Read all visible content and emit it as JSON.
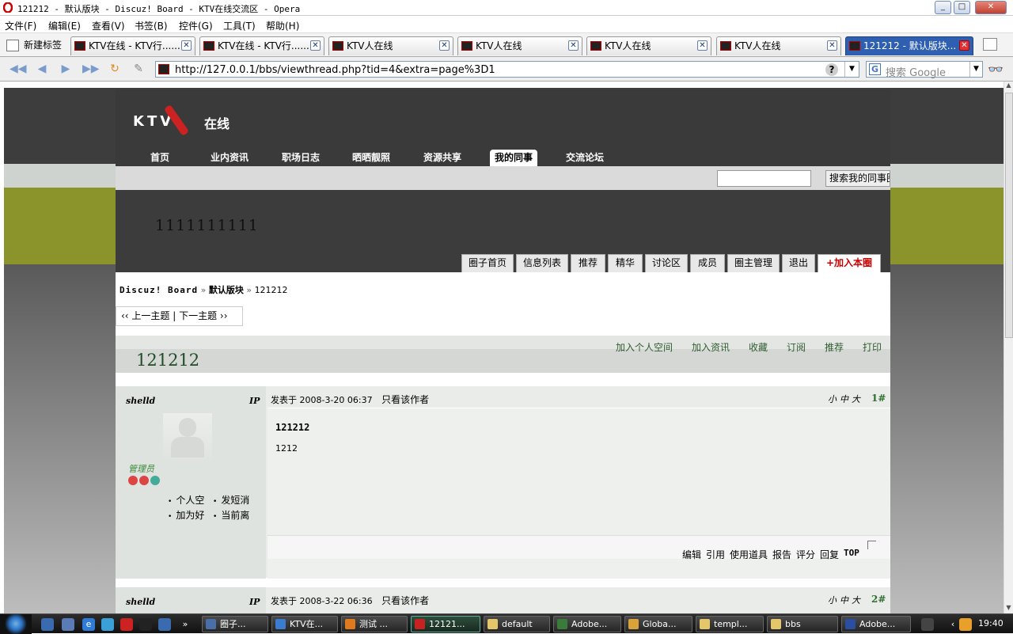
{
  "window": {
    "title": "121212 - 默认版块 - Discuz! Board - KTV在线交流区 - Opera",
    "controls": [
      "_",
      "□",
      "✕"
    ]
  },
  "menu": [
    "文件(F)",
    "编辑(E)",
    "查看(V)",
    "书签(B)",
    "控件(G)",
    "工具(T)",
    "帮助(H)"
  ],
  "tabs": {
    "new_tab_label": "新建标签",
    "items": [
      {
        "label": "KTV在线 - KTV行......",
        "active": false
      },
      {
        "label": "KTV在线 - KTV行......",
        "active": false
      },
      {
        "label": "KTV人在线",
        "active": false
      },
      {
        "label": "KTV人在线",
        "active": false
      },
      {
        "label": "KTV人在线",
        "active": false
      },
      {
        "label": "KTV人在线",
        "active": false
      },
      {
        "label": "121212 - 默认版块...",
        "active": true
      }
    ]
  },
  "address": {
    "url": "http://127.0.0.1/bbs/viewthread.php?tid=4&extra=page%3D1",
    "help": "?",
    "search_placeholder": "搜索 Google"
  },
  "site": {
    "logo_text": "KTV",
    "logo_suffix": "在线",
    "nav": [
      {
        "label": "首页",
        "active": false
      },
      {
        "label": "业内资讯",
        "active": false
      },
      {
        "label": "职场日志",
        "active": false
      },
      {
        "label": "晒晒靓照",
        "active": false
      },
      {
        "label": "资源共享",
        "active": false
      },
      {
        "label": "我的同事",
        "active": true
      },
      {
        "label": "交流论坛",
        "active": false
      }
    ],
    "search_button": "搜索我的同事圈",
    "circle_name": "1111111111",
    "circle_tabs": [
      "圈子首页",
      "信息列表",
      "推荐",
      "精华",
      "讨论区",
      "成员",
      "圈主管理",
      "退出",
      "+加入本圈"
    ]
  },
  "breadcrumb": {
    "root": "Discuz! Board",
    "sep": "»",
    "forum": "默认版块",
    "thread": "121212"
  },
  "thread_nav": "‹‹ 上一主题 | 下一主题 ››",
  "thread": {
    "title": "121212",
    "actions": [
      "加入个人空间",
      "加入资讯",
      "收藏",
      "订阅",
      "推荐",
      "打印"
    ]
  },
  "posts": [
    {
      "author": "shelld",
      "ip_label": "IP",
      "posted_label": "发表于",
      "date": "2008-3-20 06:37",
      "only_author": "只看该作者",
      "font_sizes": "小中大",
      "floor": "1#",
      "role": "管理员",
      "user_links": [
        "个人空",
        "发短消",
        "加为好",
        "当前离"
      ],
      "title": "121212",
      "text": "1212",
      "footer_actions": [
        "编辑",
        "引用",
        "使用道具",
        "报告",
        "评分",
        "回复"
      ],
      "top_label": "TOP"
    },
    {
      "author": "shelld",
      "ip_label": "IP",
      "posted_label": "发表于",
      "date": "2008-3-22 06:36",
      "only_author": "只看该作者",
      "font_sizes": "小中大",
      "floor": "2#"
    }
  ],
  "taskbar": {
    "buttons": [
      {
        "label": "圈子...",
        "active": false,
        "color": "#4a6fa8"
      },
      {
        "label": "KTV在...",
        "active": false,
        "color": "#3b7bd0"
      },
      {
        "label": "测试 ...",
        "active": false,
        "color": "#e07a1f"
      },
      {
        "label": "12121...",
        "active": true,
        "color": "#c62222"
      },
      {
        "label": "default",
        "active": false,
        "color": "#e5c76b"
      },
      {
        "label": "Adobe...",
        "active": false,
        "color": "#3a7a3a"
      },
      {
        "label": "Globa...",
        "active": false,
        "color": "#d9a23a"
      },
      {
        "label": "templ...",
        "active": false,
        "color": "#e5c76b"
      },
      {
        "label": "bbs",
        "active": false,
        "color": "#e5c76b"
      },
      {
        "label": "Adobe...",
        "active": false,
        "color": "#2a4fa0"
      }
    ],
    "clock": "19:40"
  },
  "colors": {
    "site_dark": "#3a3a3a",
    "olive_band": "#8b942b",
    "title_green": "#1f4d25",
    "join_red": "#cc0000"
  }
}
